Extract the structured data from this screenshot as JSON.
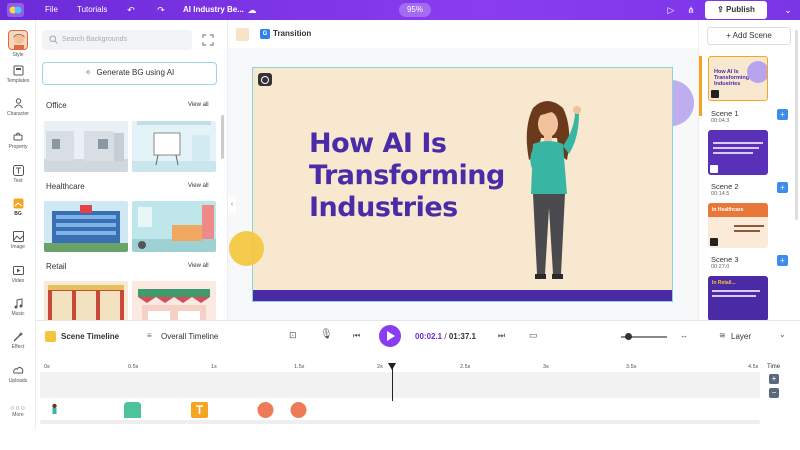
{
  "topbar": {
    "menu_file": "File",
    "menu_tutorials": "Tutorials",
    "project_title": "AI Industry Be...",
    "zoom": "95%",
    "publish_label": "Publish"
  },
  "rail": {
    "items": [
      {
        "label": "Style"
      },
      {
        "label": "Templates"
      },
      {
        "label": "Character"
      },
      {
        "label": "Property"
      },
      {
        "label": "Text"
      },
      {
        "label": "BG"
      },
      {
        "label": "Image"
      },
      {
        "label": "Video"
      },
      {
        "label": "Music"
      },
      {
        "label": "Effect"
      },
      {
        "label": "Uploads"
      },
      {
        "label": "More"
      }
    ]
  },
  "bgpanel": {
    "search_placeholder": "Search Backgrounds",
    "generate_label": "Generate BG using AI",
    "sections": [
      {
        "title": "Office",
        "view_all": "View all"
      },
      {
        "title": "Healthcare",
        "view_all": "View all"
      },
      {
        "title": "Retail",
        "view_all": "View all"
      }
    ]
  },
  "stage": {
    "transition_label": "Transition",
    "slide_title": "How AI Is Transforming Industries"
  },
  "scenes": {
    "add_label": "+ Add Scene",
    "items": [
      {
        "name": "Scene 1",
        "time": "00:04.3"
      },
      {
        "name": "Scene 2",
        "time": "00:14.5"
      },
      {
        "name": "Scene 3",
        "time": "00:27.0"
      }
    ],
    "thumb_text": [
      "How AI Is Transforming Industries",
      "In Healthcare",
      "In Retail..."
    ]
  },
  "timeline": {
    "scene_tab": "Scene Timeline",
    "overall_tab": "Overall Timeline",
    "current_time": "00:02.1",
    "total_time": "01:37.1",
    "layer_label": "Layer",
    "time_label": "Time",
    "ticks": [
      "0s",
      "0.5s",
      "1s",
      "1.5s",
      "2s",
      "2.5s",
      "3s",
      "3.5s",
      "4.5s"
    ]
  },
  "colors": {
    "brand_purple": "#7a35e6",
    "slide_bg": "#f8e8cf",
    "slide_title": "#4a2ba8",
    "accent_orange": "#f4a623"
  }
}
